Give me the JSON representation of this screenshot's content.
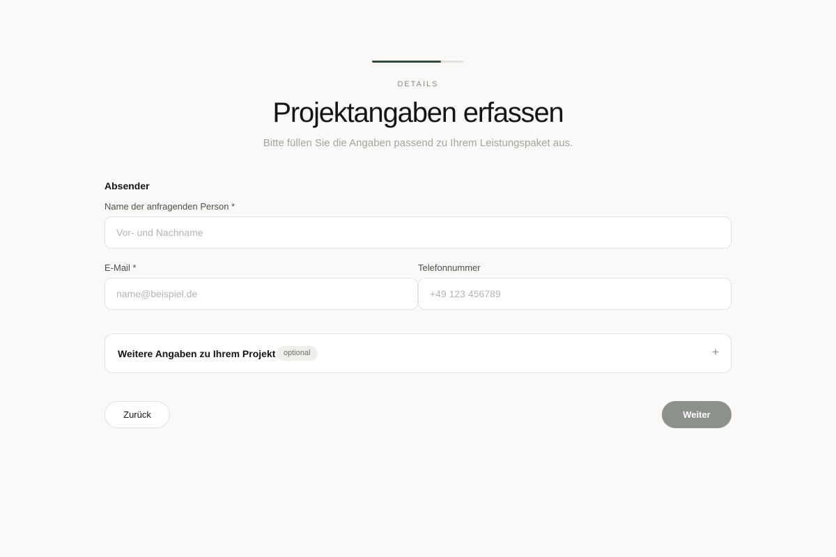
{
  "progress": {
    "fraction": 0.75
  },
  "header": {
    "step_label": "DETAILS",
    "title": "Projektangaben erfassen",
    "subtitle": "Bitte füllen Sie die Angaben passend zu Ihrem Leistungspaket aus."
  },
  "sender": {
    "section_title": "Absender",
    "name": {
      "label": "Name der anfragenden Person *",
      "value": "",
      "placeholder": "Vor- und Nachname"
    },
    "email": {
      "label": "E-Mail *",
      "value": "",
      "placeholder": "name@beispiel.de"
    },
    "phone": {
      "label": "Telefonnummer",
      "value": "",
      "placeholder": "+49 123 456789"
    }
  },
  "more_details": {
    "title": "Weitere Angaben zu Ihrem Projekt",
    "badge": "optional",
    "expand_icon": "plus-icon",
    "expand_glyph": "+"
  },
  "actions": {
    "back_label": "Zurück",
    "next_label": "Weiter"
  },
  "colors": {
    "background": "#faf9f7",
    "accent": "#2f4a3a",
    "next_button": "#8d918c"
  }
}
